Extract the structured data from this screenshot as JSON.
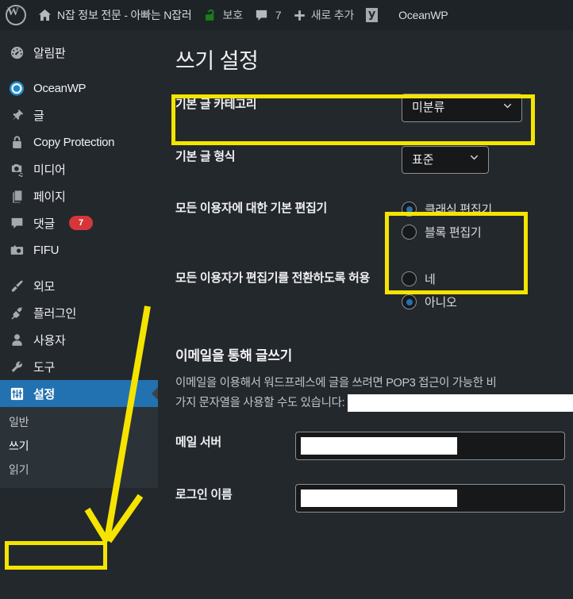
{
  "adminbar": {
    "wp_logo": "wordpress-logo",
    "site_name": "N잡 정보 전문 - 아빠는 N잡러",
    "protect_label": "보호",
    "comment_count": "7",
    "new_label": "새로 추가",
    "brand_label": "OceanWP"
  },
  "sidebar": {
    "items": [
      {
        "label": "알림판",
        "icon": "dashboard-icon",
        "badge": null
      },
      {
        "label": "OceanWP",
        "icon": "oceanwp-icon",
        "badge": null
      },
      {
        "label": "글",
        "icon": "pin-icon",
        "badge": null
      },
      {
        "label": "Copy Protection",
        "icon": "lock-icon",
        "badge": null
      },
      {
        "label": "미디어",
        "icon": "media-icon",
        "badge": null
      },
      {
        "label": "페이지",
        "icon": "page-icon",
        "badge": null
      },
      {
        "label": "댓글",
        "icon": "comment-icon",
        "badge": "7"
      },
      {
        "label": "FIFU",
        "icon": "camera-icon",
        "badge": null
      },
      {
        "label": "외모",
        "icon": "brush-icon",
        "badge": null
      },
      {
        "label": "플러그인",
        "icon": "plug-icon",
        "badge": null
      },
      {
        "label": "사용자",
        "icon": "user-icon",
        "badge": null
      },
      {
        "label": "도구",
        "icon": "wrench-icon",
        "badge": null
      },
      {
        "label": "설정",
        "icon": "settings-icon",
        "badge": null
      }
    ],
    "submenu": [
      {
        "label": "일반",
        "active": false
      },
      {
        "label": "쓰기",
        "active": true
      },
      {
        "label": "읽기",
        "active": false
      }
    ]
  },
  "main": {
    "page_title": "쓰기 설정",
    "rows": [
      {
        "label": "기본 글 카테고리",
        "control": "select",
        "value": "미분류"
      },
      {
        "label": "기본 글 형식",
        "control": "select",
        "value": "표준"
      },
      {
        "label": "모든 이용자에 대한 기본 편집기",
        "control": "radio",
        "options": [
          {
            "label": "클래식 편집기",
            "selected": true
          },
          {
            "label": "블록 편집기",
            "selected": false
          }
        ]
      },
      {
        "label": "모든 이용자가 편집기를 전환하도록 허용",
        "control": "radio",
        "options": [
          {
            "label": "네",
            "selected": false
          },
          {
            "label": "아니오",
            "selected": true
          }
        ]
      }
    ],
    "email_section": {
      "heading": "이메일을 통해 글쓰기",
      "desc_line1": "이메일을 이용해서 워드프레스에 글을 쓰려면 POP3 접근이 가능한 비",
      "desc_line2": "가지 문자열을 사용할 수도 있습니다:",
      "fields": [
        {
          "label": "메일 서버",
          "value": ""
        },
        {
          "label": "로그인 이름",
          "value": ""
        }
      ]
    }
  },
  "annotations": {
    "highlight_color": "#f5e400",
    "boxes": [
      "default-post-category",
      "default-editor",
      "writing-submenu"
    ],
    "arrow": "yellow-arrow-pointing-to-writing"
  },
  "colors": {
    "accent": "#2271b1",
    "badge": "#d63638",
    "sidebar_bg": "#23282d",
    "submenu_bg": "#2c3338",
    "highlight": "#f5e400"
  }
}
